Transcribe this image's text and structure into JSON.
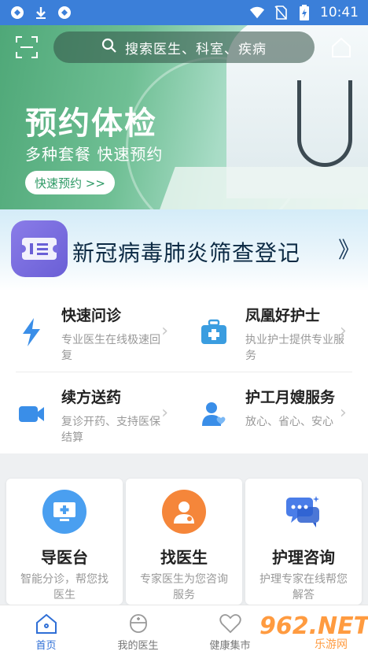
{
  "status_bar": {
    "time": "10:41",
    "icons_left": [
      "vpn-icon",
      "download-icon",
      "vpn-icon"
    ],
    "icons_right": [
      "wifi-icon",
      "no-sim-icon",
      "battery-icon"
    ]
  },
  "header": {
    "search_placeholder": "搜索医生、科室、疾病"
  },
  "banner": {
    "title": "预约体检",
    "subtitle": "多种套餐 快速预约",
    "cta_label": "快速预约 >>"
  },
  "covid": {
    "label": "新冠病毒肺炎筛查登记",
    "arrow": "》"
  },
  "services": [
    {
      "title": "快速问诊",
      "desc": "专业医生在线极速回复",
      "icon": "lightning-icon"
    },
    {
      "title": "凤凰好护士",
      "desc": "执业护士提供专业服务",
      "icon": "medical-kit-icon"
    },
    {
      "title": "续方送药",
      "desc": "复诊开药、支持医保结算",
      "icon": "video-camera-icon"
    },
    {
      "title": "护工月嫂服务",
      "desc": "放心、省心、安心",
      "icon": "caregiver-icon"
    }
  ],
  "cards": [
    {
      "title": "导医台",
      "desc": "智能分诊，帮您找医生",
      "icon": "monitor-plus-icon",
      "color": "#4a9ff0"
    },
    {
      "title": "找医生",
      "desc": "专家医生为您咨询服务",
      "icon": "doctor-icon",
      "color": "#f5863a"
    },
    {
      "title": "护理咨询",
      "desc": "护理专家在线帮您解答",
      "icon": "chat-bubbles-icon",
      "color": "#4a7de8"
    }
  ],
  "bottom_nav": [
    {
      "label": "首页",
      "active": true
    },
    {
      "label": "我的医生",
      "active": false
    },
    {
      "label": "健康集市",
      "active": false
    }
  ],
  "watermark": {
    "brand": "962.NET",
    "site": "乐游网"
  },
  "colors": {
    "status_bar": "#3b7fd9",
    "accent": "#2f6fd6",
    "banner_green": "#4fa878"
  }
}
